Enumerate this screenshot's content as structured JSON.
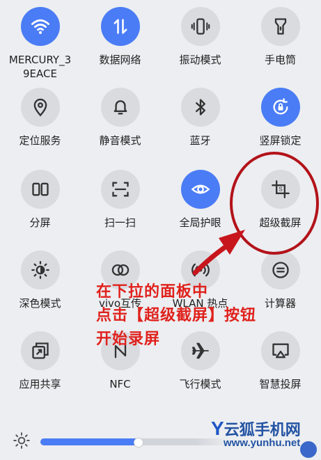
{
  "colors": {
    "accent": "#4a7cf5",
    "tile_bg": "#d9dbdf",
    "annotation": "#e0211c",
    "ring": "#b3131a"
  },
  "tiles": [
    {
      "label": "MERCURY_3\n9EACE",
      "icon": "wifi-icon",
      "active": true
    },
    {
      "label": "数据网络",
      "icon": "mobile-data-icon",
      "active": true
    },
    {
      "label": "振动模式",
      "icon": "vibrate-icon",
      "active": false
    },
    {
      "label": "手电筒",
      "icon": "flashlight-icon",
      "active": false
    },
    {
      "label": "定位服务",
      "icon": "location-icon",
      "active": false
    },
    {
      "label": "静音模式",
      "icon": "bell-icon",
      "active": false
    },
    {
      "label": "蓝牙",
      "icon": "bluetooth-icon",
      "active": false
    },
    {
      "label": "竖屏锁定",
      "icon": "rotation-lock-icon",
      "active": true
    },
    {
      "label": "分屏",
      "icon": "split-screen-icon",
      "active": false
    },
    {
      "label": "扫一扫",
      "icon": "scan-icon",
      "active": false
    },
    {
      "label": "全局护眼",
      "icon": "eye-icon",
      "active": true
    },
    {
      "label": "超级截屏",
      "icon": "screenshot-crop-icon",
      "active": false
    },
    {
      "label": "深色模式",
      "icon": "dark-mode-icon",
      "active": false
    },
    {
      "label": "vivo互传",
      "icon": "share-rings-icon",
      "active": false
    },
    {
      "label": "WLAN 热点",
      "icon": "hotspot-icon",
      "active": false
    },
    {
      "label": "计算器",
      "icon": "calculator-icon",
      "active": false
    },
    {
      "label": "应用共享",
      "icon": "app-share-icon",
      "active": false
    },
    {
      "label": "NFC",
      "icon": "nfc-icon",
      "active": false
    },
    {
      "label": "飞行模式",
      "icon": "airplane-icon",
      "active": false
    },
    {
      "label": "智慧投屏",
      "icon": "cast-icon",
      "active": false
    }
  ],
  "annotation": {
    "lines": [
      "在下拉的面板中",
      "点击【超级截屏】按钮",
      "开始录屏"
    ]
  },
  "brightness": {
    "icon": "sun-icon",
    "level": 0.47
  },
  "watermark": {
    "title": "云狐手机网",
    "url": "www.yunhu.net",
    "logo_letter": "Y"
  }
}
